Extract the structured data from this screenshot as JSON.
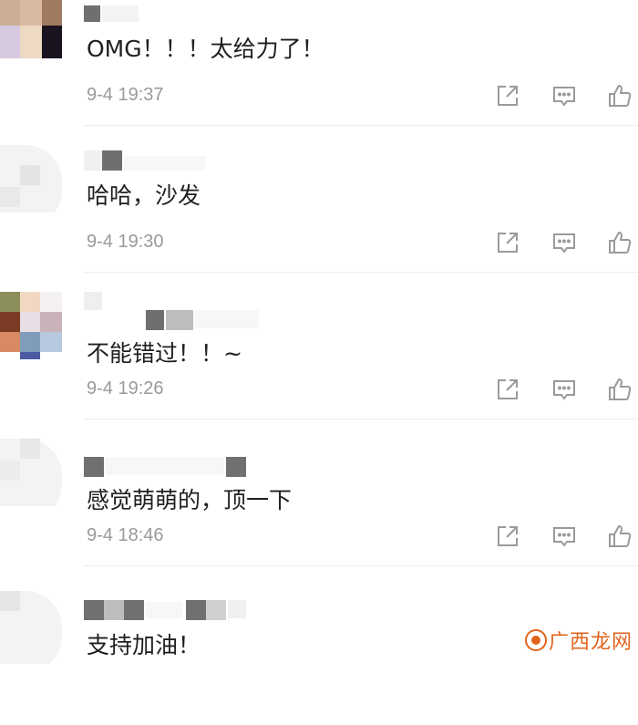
{
  "comments": [
    {
      "text": "OMG！！！太给力了！",
      "time": "9-4 19:37"
    },
    {
      "text": "哈哈，沙发",
      "time": "9-4 19:30"
    },
    {
      "text": "不能错过！！~",
      "time": "9-4 19:26"
    },
    {
      "text": "感觉萌萌的，顶一下",
      "time": "9-4 18:46"
    },
    {
      "text": "支持加油！",
      "time": ""
    }
  ],
  "icons": {
    "share": "share-icon",
    "reply": "comment-icon",
    "like": "thumbs-up-icon"
  },
  "watermark": {
    "text": "广西龙网"
  },
  "colors": {
    "text": "#1f1f1f",
    "time": "#9a9a9a",
    "icon": "#9a9a9a",
    "watermark": "#e0641e"
  }
}
